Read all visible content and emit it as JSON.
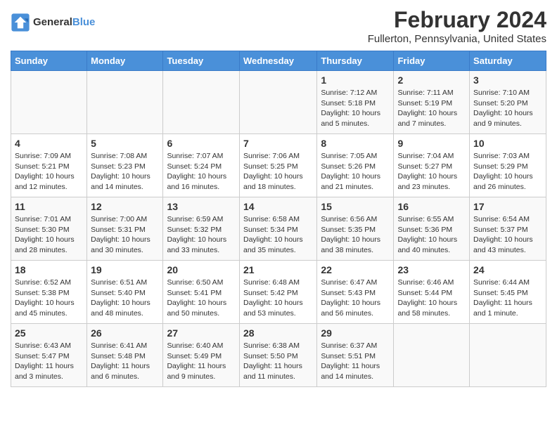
{
  "logo": {
    "text_general": "General",
    "text_blue": "Blue"
  },
  "header": {
    "month": "February 2024",
    "location": "Fullerton, Pennsylvania, United States"
  },
  "weekdays": [
    "Sunday",
    "Monday",
    "Tuesday",
    "Wednesday",
    "Thursday",
    "Friday",
    "Saturday"
  ],
  "weeks": [
    [
      {
        "day": "",
        "info": ""
      },
      {
        "day": "",
        "info": ""
      },
      {
        "day": "",
        "info": ""
      },
      {
        "day": "",
        "info": ""
      },
      {
        "day": "1",
        "info": "Sunrise: 7:12 AM\nSunset: 5:18 PM\nDaylight: 10 hours\nand 5 minutes."
      },
      {
        "day": "2",
        "info": "Sunrise: 7:11 AM\nSunset: 5:19 PM\nDaylight: 10 hours\nand 7 minutes."
      },
      {
        "day": "3",
        "info": "Sunrise: 7:10 AM\nSunset: 5:20 PM\nDaylight: 10 hours\nand 9 minutes."
      }
    ],
    [
      {
        "day": "4",
        "info": "Sunrise: 7:09 AM\nSunset: 5:21 PM\nDaylight: 10 hours\nand 12 minutes."
      },
      {
        "day": "5",
        "info": "Sunrise: 7:08 AM\nSunset: 5:23 PM\nDaylight: 10 hours\nand 14 minutes."
      },
      {
        "day": "6",
        "info": "Sunrise: 7:07 AM\nSunset: 5:24 PM\nDaylight: 10 hours\nand 16 minutes."
      },
      {
        "day": "7",
        "info": "Sunrise: 7:06 AM\nSunset: 5:25 PM\nDaylight: 10 hours\nand 18 minutes."
      },
      {
        "day": "8",
        "info": "Sunrise: 7:05 AM\nSunset: 5:26 PM\nDaylight: 10 hours\nand 21 minutes."
      },
      {
        "day": "9",
        "info": "Sunrise: 7:04 AM\nSunset: 5:27 PM\nDaylight: 10 hours\nand 23 minutes."
      },
      {
        "day": "10",
        "info": "Sunrise: 7:03 AM\nSunset: 5:29 PM\nDaylight: 10 hours\nand 26 minutes."
      }
    ],
    [
      {
        "day": "11",
        "info": "Sunrise: 7:01 AM\nSunset: 5:30 PM\nDaylight: 10 hours\nand 28 minutes."
      },
      {
        "day": "12",
        "info": "Sunrise: 7:00 AM\nSunset: 5:31 PM\nDaylight: 10 hours\nand 30 minutes."
      },
      {
        "day": "13",
        "info": "Sunrise: 6:59 AM\nSunset: 5:32 PM\nDaylight: 10 hours\nand 33 minutes."
      },
      {
        "day": "14",
        "info": "Sunrise: 6:58 AM\nSunset: 5:34 PM\nDaylight: 10 hours\nand 35 minutes."
      },
      {
        "day": "15",
        "info": "Sunrise: 6:56 AM\nSunset: 5:35 PM\nDaylight: 10 hours\nand 38 minutes."
      },
      {
        "day": "16",
        "info": "Sunrise: 6:55 AM\nSunset: 5:36 PM\nDaylight: 10 hours\nand 40 minutes."
      },
      {
        "day": "17",
        "info": "Sunrise: 6:54 AM\nSunset: 5:37 PM\nDaylight: 10 hours\nand 43 minutes."
      }
    ],
    [
      {
        "day": "18",
        "info": "Sunrise: 6:52 AM\nSunset: 5:38 PM\nDaylight: 10 hours\nand 45 minutes."
      },
      {
        "day": "19",
        "info": "Sunrise: 6:51 AM\nSunset: 5:40 PM\nDaylight: 10 hours\nand 48 minutes."
      },
      {
        "day": "20",
        "info": "Sunrise: 6:50 AM\nSunset: 5:41 PM\nDaylight: 10 hours\nand 50 minutes."
      },
      {
        "day": "21",
        "info": "Sunrise: 6:48 AM\nSunset: 5:42 PM\nDaylight: 10 hours\nand 53 minutes."
      },
      {
        "day": "22",
        "info": "Sunrise: 6:47 AM\nSunset: 5:43 PM\nDaylight: 10 hours\nand 56 minutes."
      },
      {
        "day": "23",
        "info": "Sunrise: 6:46 AM\nSunset: 5:44 PM\nDaylight: 10 hours\nand 58 minutes."
      },
      {
        "day": "24",
        "info": "Sunrise: 6:44 AM\nSunset: 5:45 PM\nDaylight: 11 hours\nand 1 minute."
      }
    ],
    [
      {
        "day": "25",
        "info": "Sunrise: 6:43 AM\nSunset: 5:47 PM\nDaylight: 11 hours\nand 3 minutes."
      },
      {
        "day": "26",
        "info": "Sunrise: 6:41 AM\nSunset: 5:48 PM\nDaylight: 11 hours\nand 6 minutes."
      },
      {
        "day": "27",
        "info": "Sunrise: 6:40 AM\nSunset: 5:49 PM\nDaylight: 11 hours\nand 9 minutes."
      },
      {
        "day": "28",
        "info": "Sunrise: 6:38 AM\nSunset: 5:50 PM\nDaylight: 11 hours\nand 11 minutes."
      },
      {
        "day": "29",
        "info": "Sunrise: 6:37 AM\nSunset: 5:51 PM\nDaylight: 11 hours\nand 14 minutes."
      },
      {
        "day": "",
        "info": ""
      },
      {
        "day": "",
        "info": ""
      }
    ]
  ]
}
